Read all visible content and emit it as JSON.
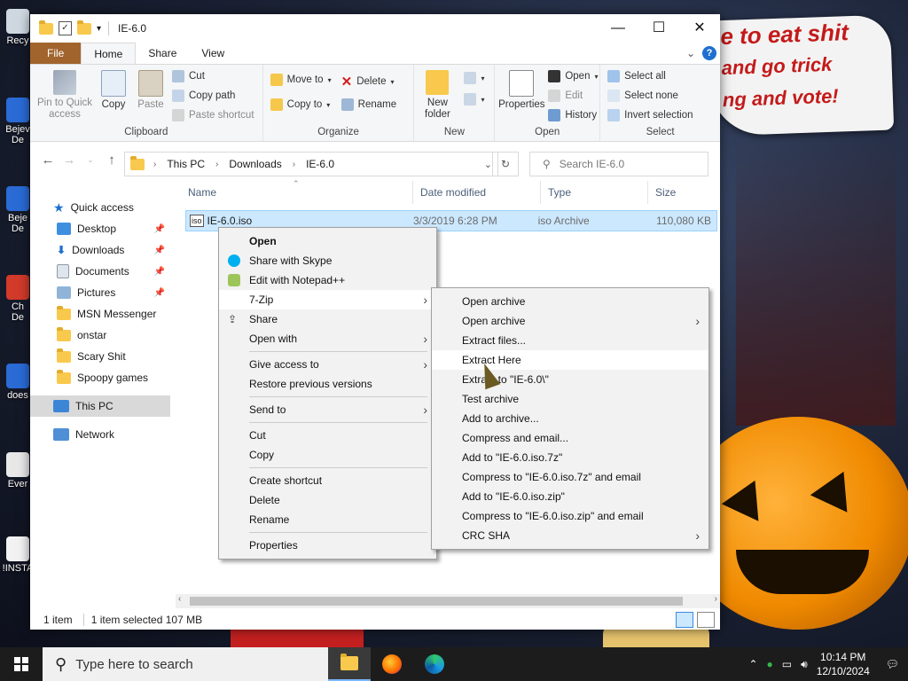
{
  "desktop": {
    "icons": [
      "Recy",
      "Bejev\nDe",
      "Beje\nDe",
      "Ch\nDe",
      "does",
      "Ever",
      "!INSTA"
    ],
    "banner_lines": [
      "e to eat shit",
      "and go trick",
      "ng and vote!"
    ]
  },
  "window": {
    "title": "IE-6.0",
    "controls": {
      "minimize": "—",
      "maximize": "☐",
      "close": "✕"
    },
    "tabs": [
      "File",
      "Home",
      "Share",
      "View"
    ],
    "help": "?",
    "ribbon": {
      "clipboard": {
        "label": "Clipboard",
        "pin": "Pin to Quick\naccess",
        "copy": "Copy",
        "paste": "Paste",
        "cut": "Cut",
        "copy_path": "Copy path",
        "paste_shortcut": "Paste shortcut"
      },
      "organize": {
        "label": "Organize",
        "move_to": "Move to",
        "copy_to": "Copy to",
        "delete": "Delete",
        "rename": "Rename"
      },
      "new": {
        "label": "New",
        "new_folder": "New\nfolder"
      },
      "open": {
        "label": "Open",
        "properties": "Properties",
        "open": "Open",
        "edit": "Edit",
        "history": "History"
      },
      "select": {
        "label": "Select",
        "select_all": "Select all",
        "select_none": "Select none",
        "invert": "Invert selection"
      }
    },
    "address": {
      "crumbs": [
        "This PC",
        "Downloads",
        "IE-6.0"
      ],
      "search_placeholder": "Search IE-6.0"
    },
    "nav": [
      {
        "label": "Quick access",
        "pinned": false,
        "top": true
      },
      {
        "label": "Desktop",
        "pinned": true
      },
      {
        "label": "Downloads",
        "pinned": true
      },
      {
        "label": "Documents",
        "pinned": true
      },
      {
        "label": "Pictures",
        "pinned": true
      },
      {
        "label": "MSN Messenger",
        "pinned": false
      },
      {
        "label": "onstar",
        "pinned": false
      },
      {
        "label": "Scary Shit",
        "pinned": false
      },
      {
        "label": "Spoopy games",
        "pinned": false
      },
      {
        "label": "This PC",
        "pinned": false,
        "top": true,
        "selected": true
      },
      {
        "label": "Network",
        "pinned": false,
        "top": true
      }
    ],
    "columns": [
      "Name",
      "Date modified",
      "Type",
      "Size"
    ],
    "files": [
      {
        "name": "IE-6.0.iso",
        "date": "3/3/2019 6:28 PM",
        "type": "iso Archive",
        "size": "110,080 KB",
        "icon_text": "iso"
      }
    ],
    "status": {
      "count": "1 item",
      "selected": "1 item selected  107 MB"
    }
  },
  "context_menu": {
    "items": [
      {
        "label": "Open",
        "bold": true
      },
      {
        "label": "Share with Skype",
        "icon": "skype-icon"
      },
      {
        "label": "Edit with Notepad++",
        "icon": "notepadpp-icon"
      },
      {
        "label": "7-Zip",
        "submenu": true,
        "highlight": true
      },
      {
        "label": "Share",
        "icon": "share-icon"
      },
      {
        "label": "Open with",
        "submenu": true
      },
      {
        "sep": true
      },
      {
        "label": "Give access to",
        "submenu": true
      },
      {
        "label": "Restore previous versions"
      },
      {
        "sep": true
      },
      {
        "label": "Send to",
        "submenu": true
      },
      {
        "sep": true
      },
      {
        "label": "Cut"
      },
      {
        "label": "Copy"
      },
      {
        "sep": true
      },
      {
        "label": "Create shortcut"
      },
      {
        "label": "Delete"
      },
      {
        "label": "Rename"
      },
      {
        "sep": true
      },
      {
        "label": "Properties"
      }
    ]
  },
  "zip_menu": {
    "items": [
      {
        "label": "Open archive"
      },
      {
        "label": "Open archive",
        "submenu": true
      },
      {
        "label": "Extract files..."
      },
      {
        "label": "Extract Here",
        "highlight": true
      },
      {
        "label": "Extract to \"IE-6.0\\\""
      },
      {
        "label": "Test archive"
      },
      {
        "label": "Add to archive..."
      },
      {
        "label": "Compress and email..."
      },
      {
        "label": "Add to \"IE-6.0.iso.7z\""
      },
      {
        "label": "Compress to \"IE-6.0.iso.7z\" and email"
      },
      {
        "label": "Add to \"IE-6.0.iso.zip\""
      },
      {
        "label": "Compress to \"IE-6.0.iso.zip\" and email"
      },
      {
        "label": "CRC SHA",
        "submenu": true
      }
    ]
  },
  "taskbar": {
    "search_placeholder": "Type here to search",
    "apps": [
      "file-explorer-icon",
      "firefox-icon",
      "edge-icon"
    ],
    "time": "10:14 PM",
    "date": "12/10/2024"
  },
  "colors": {
    "file_tab": "#a1642d",
    "selection": "#cce8ff",
    "accent": "#1e6fd0"
  }
}
